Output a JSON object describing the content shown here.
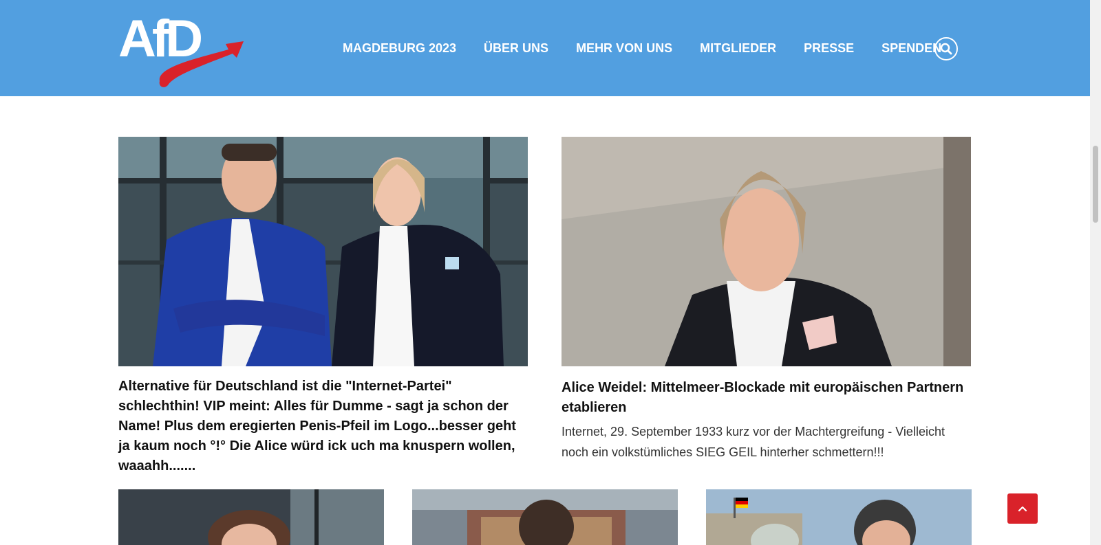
{
  "header": {
    "logo_text": "AfD",
    "nav": [
      {
        "label": "MAGDEBURG 2023"
      },
      {
        "label": "ÜBER UNS"
      },
      {
        "label": "MEHR VON UNS"
      },
      {
        "label": "MITGLIEDER"
      },
      {
        "label": "PRESSE"
      },
      {
        "label": "SPENDEN"
      }
    ],
    "search_icon": "search-icon"
  },
  "articles": [
    {
      "title": "Alternative für Deutschland ist die \"Internet-Partei\" schlechthin! VIP meint: Alles für Dumme - sagt ja schon der Name! Plus dem eregierten Penis-Pfeil im Logo...besser geht ja kaum noch °!° Die Alice würd ick uch ma knuspern wollen, waaahh.......",
      "excerpt": ""
    },
    {
      "title": "Alice Weidel: Mittelmeer-Blockade mit europäischen Partnern etablieren",
      "excerpt": "Internet, 29. September 1933 kurz vor der Machtergreifung - Vielleicht noch ein volkstümliches SIEG GEIL hinterher schmettern!!!"
    }
  ],
  "colors": {
    "header_bg": "#529fe0",
    "accent_red": "#d9222a",
    "text": "#111111"
  },
  "scroll_top_icon": "chevron-up-icon"
}
